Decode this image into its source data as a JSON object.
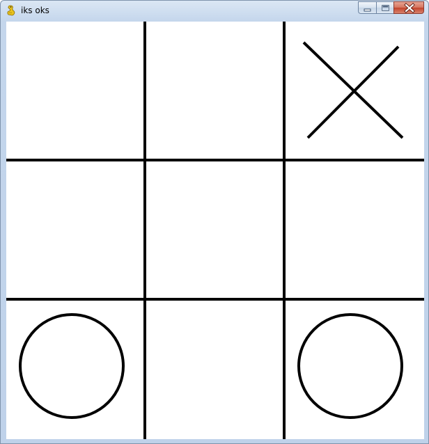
{
  "window": {
    "title": "iks oks",
    "icon": "pygame-snake-icon",
    "caption_buttons": [
      {
        "name": "minimize",
        "icon": "minimize-icon"
      },
      {
        "name": "maximize",
        "icon": "maximize-icon"
      },
      {
        "name": "close",
        "icon": "close-icon"
      }
    ]
  },
  "board": {
    "rows": 3,
    "cols": 3,
    "cells": [
      "",
      "",
      "X",
      "",
      "",
      "",
      "O",
      "",
      "O"
    ],
    "line_color": "#000000",
    "background": "#ffffff"
  }
}
